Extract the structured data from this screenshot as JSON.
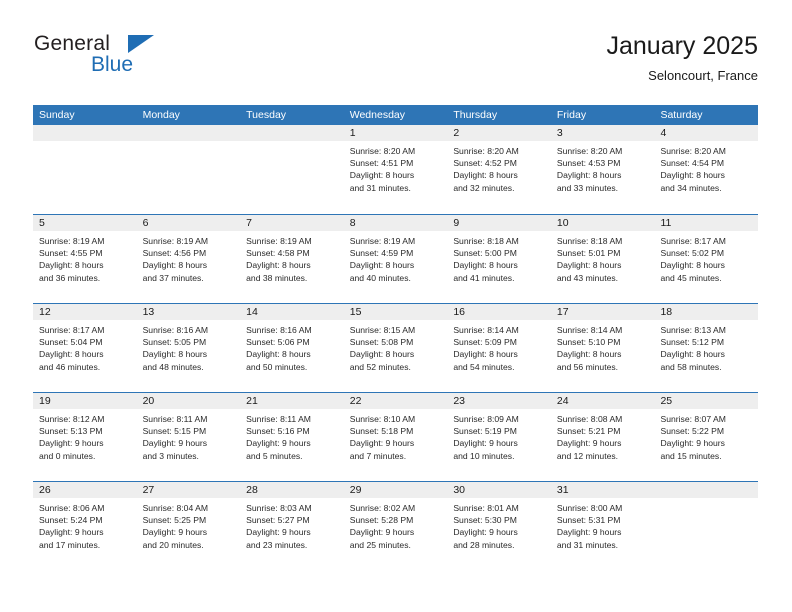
{
  "brand": {
    "name_part1": "General",
    "name_part2": "Blue",
    "accent_color": "#1f6db4"
  },
  "header": {
    "title": "January 2025",
    "location": "Seloncourt, France"
  },
  "calendar": {
    "header_color": "#2e75b6",
    "weekdays": [
      "Sunday",
      "Monday",
      "Tuesday",
      "Wednesday",
      "Thursday",
      "Friday",
      "Saturday"
    ],
    "weeks": [
      [
        {
          "date": "",
          "sunrise": "",
          "sunset": "",
          "daylight_line1": "",
          "daylight_line2": ""
        },
        {
          "date": "",
          "sunrise": "",
          "sunset": "",
          "daylight_line1": "",
          "daylight_line2": ""
        },
        {
          "date": "",
          "sunrise": "",
          "sunset": "",
          "daylight_line1": "",
          "daylight_line2": ""
        },
        {
          "date": "1",
          "sunrise": "Sunrise: 8:20 AM",
          "sunset": "Sunset: 4:51 PM",
          "daylight_line1": "Daylight: 8 hours",
          "daylight_line2": "and 31 minutes."
        },
        {
          "date": "2",
          "sunrise": "Sunrise: 8:20 AM",
          "sunset": "Sunset: 4:52 PM",
          "daylight_line1": "Daylight: 8 hours",
          "daylight_line2": "and 32 minutes."
        },
        {
          "date": "3",
          "sunrise": "Sunrise: 8:20 AM",
          "sunset": "Sunset: 4:53 PM",
          "daylight_line1": "Daylight: 8 hours",
          "daylight_line2": "and 33 minutes."
        },
        {
          "date": "4",
          "sunrise": "Sunrise: 8:20 AM",
          "sunset": "Sunset: 4:54 PM",
          "daylight_line1": "Daylight: 8 hours",
          "daylight_line2": "and 34 minutes."
        }
      ],
      [
        {
          "date": "5",
          "sunrise": "Sunrise: 8:19 AM",
          "sunset": "Sunset: 4:55 PM",
          "daylight_line1": "Daylight: 8 hours",
          "daylight_line2": "and 36 minutes."
        },
        {
          "date": "6",
          "sunrise": "Sunrise: 8:19 AM",
          "sunset": "Sunset: 4:56 PM",
          "daylight_line1": "Daylight: 8 hours",
          "daylight_line2": "and 37 minutes."
        },
        {
          "date": "7",
          "sunrise": "Sunrise: 8:19 AM",
          "sunset": "Sunset: 4:58 PM",
          "daylight_line1": "Daylight: 8 hours",
          "daylight_line2": "and 38 minutes."
        },
        {
          "date": "8",
          "sunrise": "Sunrise: 8:19 AM",
          "sunset": "Sunset: 4:59 PM",
          "daylight_line1": "Daylight: 8 hours",
          "daylight_line2": "and 40 minutes."
        },
        {
          "date": "9",
          "sunrise": "Sunrise: 8:18 AM",
          "sunset": "Sunset: 5:00 PM",
          "daylight_line1": "Daylight: 8 hours",
          "daylight_line2": "and 41 minutes."
        },
        {
          "date": "10",
          "sunrise": "Sunrise: 8:18 AM",
          "sunset": "Sunset: 5:01 PM",
          "daylight_line1": "Daylight: 8 hours",
          "daylight_line2": "and 43 minutes."
        },
        {
          "date": "11",
          "sunrise": "Sunrise: 8:17 AM",
          "sunset": "Sunset: 5:02 PM",
          "daylight_line1": "Daylight: 8 hours",
          "daylight_line2": "and 45 minutes."
        }
      ],
      [
        {
          "date": "12",
          "sunrise": "Sunrise: 8:17 AM",
          "sunset": "Sunset: 5:04 PM",
          "daylight_line1": "Daylight: 8 hours",
          "daylight_line2": "and 46 minutes."
        },
        {
          "date": "13",
          "sunrise": "Sunrise: 8:16 AM",
          "sunset": "Sunset: 5:05 PM",
          "daylight_line1": "Daylight: 8 hours",
          "daylight_line2": "and 48 minutes."
        },
        {
          "date": "14",
          "sunrise": "Sunrise: 8:16 AM",
          "sunset": "Sunset: 5:06 PM",
          "daylight_line1": "Daylight: 8 hours",
          "daylight_line2": "and 50 minutes."
        },
        {
          "date": "15",
          "sunrise": "Sunrise: 8:15 AM",
          "sunset": "Sunset: 5:08 PM",
          "daylight_line1": "Daylight: 8 hours",
          "daylight_line2": "and 52 minutes."
        },
        {
          "date": "16",
          "sunrise": "Sunrise: 8:14 AM",
          "sunset": "Sunset: 5:09 PM",
          "daylight_line1": "Daylight: 8 hours",
          "daylight_line2": "and 54 minutes."
        },
        {
          "date": "17",
          "sunrise": "Sunrise: 8:14 AM",
          "sunset": "Sunset: 5:10 PM",
          "daylight_line1": "Daylight: 8 hours",
          "daylight_line2": "and 56 minutes."
        },
        {
          "date": "18",
          "sunrise": "Sunrise: 8:13 AM",
          "sunset": "Sunset: 5:12 PM",
          "daylight_line1": "Daylight: 8 hours",
          "daylight_line2": "and 58 minutes."
        }
      ],
      [
        {
          "date": "19",
          "sunrise": "Sunrise: 8:12 AM",
          "sunset": "Sunset: 5:13 PM",
          "daylight_line1": "Daylight: 9 hours",
          "daylight_line2": "and 0 minutes."
        },
        {
          "date": "20",
          "sunrise": "Sunrise: 8:11 AM",
          "sunset": "Sunset: 5:15 PM",
          "daylight_line1": "Daylight: 9 hours",
          "daylight_line2": "and 3 minutes."
        },
        {
          "date": "21",
          "sunrise": "Sunrise: 8:11 AM",
          "sunset": "Sunset: 5:16 PM",
          "daylight_line1": "Daylight: 9 hours",
          "daylight_line2": "and 5 minutes."
        },
        {
          "date": "22",
          "sunrise": "Sunrise: 8:10 AM",
          "sunset": "Sunset: 5:18 PM",
          "daylight_line1": "Daylight: 9 hours",
          "daylight_line2": "and 7 minutes."
        },
        {
          "date": "23",
          "sunrise": "Sunrise: 8:09 AM",
          "sunset": "Sunset: 5:19 PM",
          "daylight_line1": "Daylight: 9 hours",
          "daylight_line2": "and 10 minutes."
        },
        {
          "date": "24",
          "sunrise": "Sunrise: 8:08 AM",
          "sunset": "Sunset: 5:21 PM",
          "daylight_line1": "Daylight: 9 hours",
          "daylight_line2": "and 12 minutes."
        },
        {
          "date": "25",
          "sunrise": "Sunrise: 8:07 AM",
          "sunset": "Sunset: 5:22 PM",
          "daylight_line1": "Daylight: 9 hours",
          "daylight_line2": "and 15 minutes."
        }
      ],
      [
        {
          "date": "26",
          "sunrise": "Sunrise: 8:06 AM",
          "sunset": "Sunset: 5:24 PM",
          "daylight_line1": "Daylight: 9 hours",
          "daylight_line2": "and 17 minutes."
        },
        {
          "date": "27",
          "sunrise": "Sunrise: 8:04 AM",
          "sunset": "Sunset: 5:25 PM",
          "daylight_line1": "Daylight: 9 hours",
          "daylight_line2": "and 20 minutes."
        },
        {
          "date": "28",
          "sunrise": "Sunrise: 8:03 AM",
          "sunset": "Sunset: 5:27 PM",
          "daylight_line1": "Daylight: 9 hours",
          "daylight_line2": "and 23 minutes."
        },
        {
          "date": "29",
          "sunrise": "Sunrise: 8:02 AM",
          "sunset": "Sunset: 5:28 PM",
          "daylight_line1": "Daylight: 9 hours",
          "daylight_line2": "and 25 minutes."
        },
        {
          "date": "30",
          "sunrise": "Sunrise: 8:01 AM",
          "sunset": "Sunset: 5:30 PM",
          "daylight_line1": "Daylight: 9 hours",
          "daylight_line2": "and 28 minutes."
        },
        {
          "date": "31",
          "sunrise": "Sunrise: 8:00 AM",
          "sunset": "Sunset: 5:31 PM",
          "daylight_line1": "Daylight: 9 hours",
          "daylight_line2": "and 31 minutes."
        },
        {
          "date": "",
          "sunrise": "",
          "sunset": "",
          "daylight_line1": "",
          "daylight_line2": ""
        }
      ]
    ]
  }
}
